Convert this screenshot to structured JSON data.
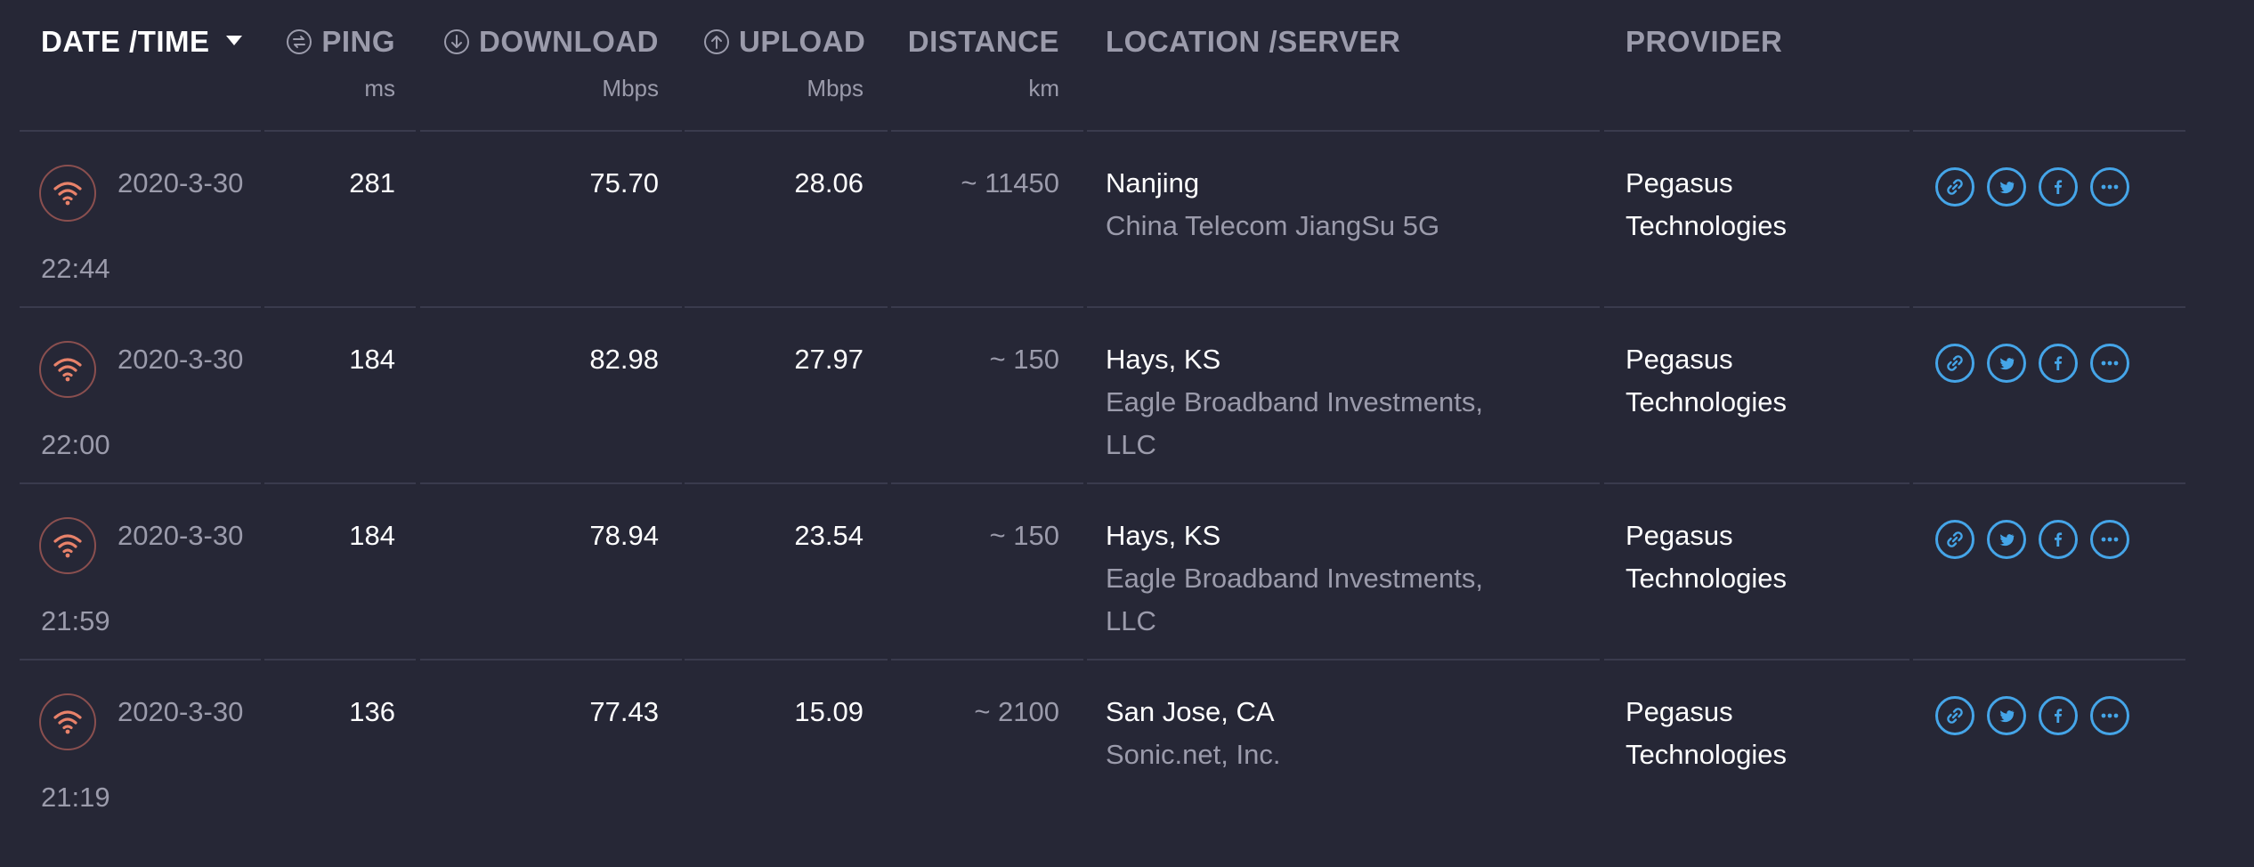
{
  "columns": {
    "date": {
      "label": "DATE /TIME"
    },
    "ping": {
      "label": "PING",
      "unit": "ms"
    },
    "download": {
      "label": "DOWNLOAD",
      "unit": "Mbps"
    },
    "upload": {
      "label": "UPLOAD",
      "unit": "Mbps"
    },
    "distance": {
      "label": "DISTANCE",
      "unit": "km"
    },
    "location": {
      "label": "LOCATION /SERVER"
    },
    "provider": {
      "label": "PROVIDER"
    }
  },
  "icons": {
    "connection": "wifi-icon",
    "ping": "ping-icon",
    "download": "download-icon",
    "upload": "upload-icon",
    "sort": "caret-down-icon",
    "share": [
      "link-icon",
      "twitter-icon",
      "facebook-icon",
      "more-icon"
    ]
  },
  "colors": {
    "background": "#262736",
    "text": "#ffffff",
    "muted": "#9b9bab",
    "wifi": "#e8826a",
    "share": "#45a5e8"
  },
  "rows": [
    {
      "date": "2020-3-30",
      "time": "22:44",
      "ping": "281",
      "download": "75.70",
      "upload": "28.06",
      "distance": "~ 11450",
      "location": "Nanjing",
      "server_line1": "China Telecom JiangSu 5G",
      "server_line2": "",
      "provider_line1": "Pegasus",
      "provider_line2": "Technologies"
    },
    {
      "date": "2020-3-30",
      "time": "22:00",
      "ping": "184",
      "download": "82.98",
      "upload": "27.97",
      "distance": "~ 150",
      "location": "Hays, KS",
      "server_line1": "Eagle Broadband Investments,",
      "server_line2": "LLC",
      "provider_line1": "Pegasus",
      "provider_line2": "Technologies"
    },
    {
      "date": "2020-3-30",
      "time": "21:59",
      "ping": "184",
      "download": "78.94",
      "upload": "23.54",
      "distance": "~ 150",
      "location": "Hays, KS",
      "server_line1": "Eagle Broadband Investments,",
      "server_line2": "LLC",
      "provider_line1": "Pegasus",
      "provider_line2": "Technologies"
    },
    {
      "date": "2020-3-30",
      "time": "21:19",
      "ping": "136",
      "download": "77.43",
      "upload": "15.09",
      "distance": "~ 2100",
      "location": "San Jose, CA",
      "server_line1": "Sonic.net, Inc.",
      "server_line2": "",
      "provider_line1": "Pegasus",
      "provider_line2": "Technologies"
    }
  ]
}
